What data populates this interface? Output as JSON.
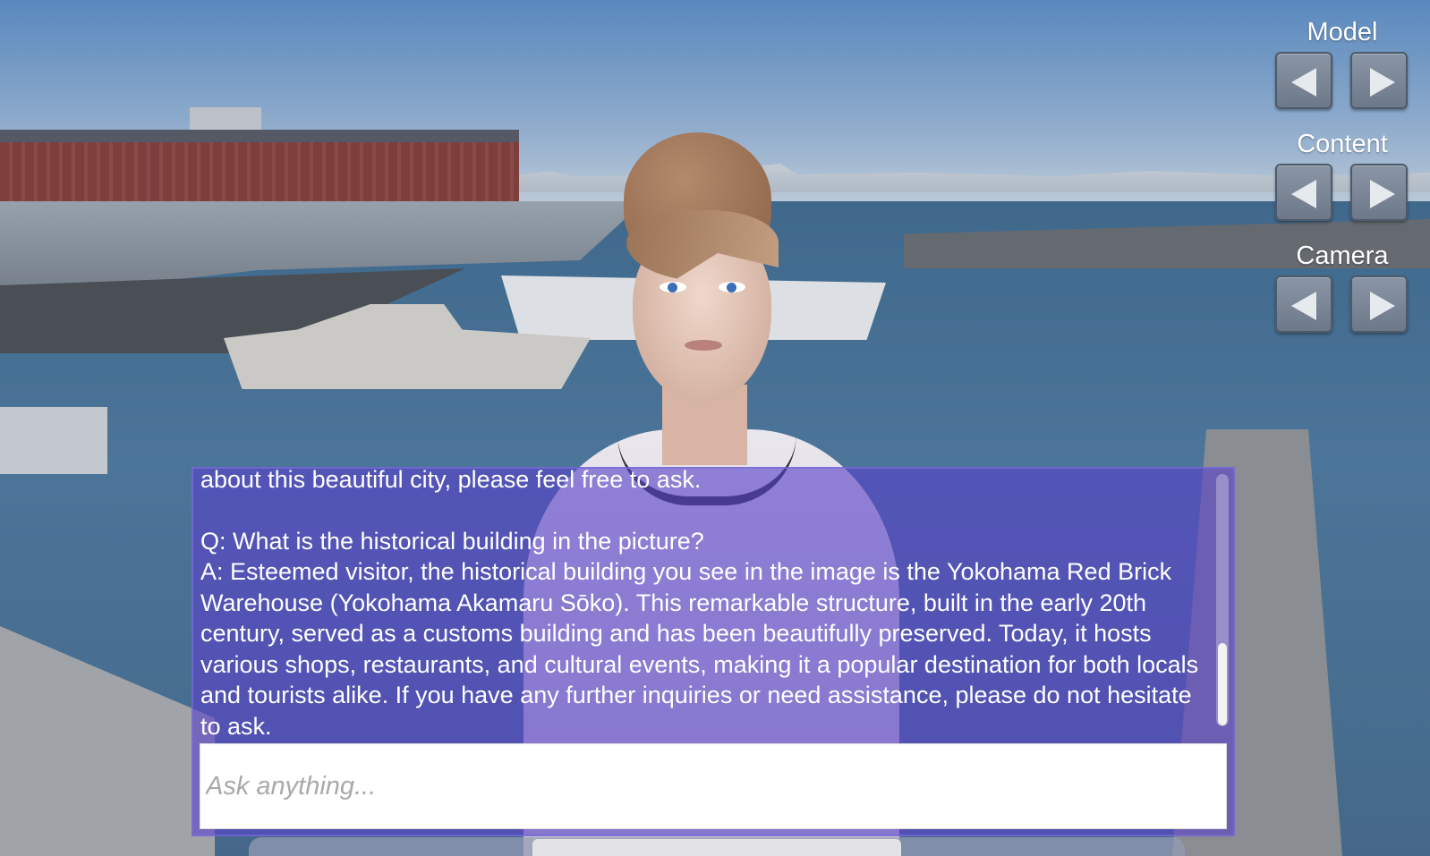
{
  "controls": {
    "model": {
      "label": "Model"
    },
    "content": {
      "label": "Content"
    },
    "camera": {
      "label": "Camera"
    }
  },
  "chat": {
    "log": {
      "cut_line": "about this beautiful city, please feel free to ask.",
      "question": "Q: What is the historical building in the picture?",
      "answer": "A: Esteemed visitor, the historical building you see in the image is the Yokohama Red Brick Warehouse (Yokohama Akamaru Sōko). This remarkable structure, built in the early 20th century, served as a customs building and has been beautifully preserved. Today, it hosts various shops, restaurants, and cultural events, making it a popular destination for both locals and tourists alike. If you have any further inquiries or need assistance, please do not hesitate to ask."
    },
    "input": {
      "placeholder": "Ask anything...",
      "value": ""
    }
  },
  "colors": {
    "chat_panel": "#5842c8",
    "button_face": "#7a8697",
    "arrow": "#e6e9ee"
  },
  "icons": {
    "prev": "triangle-left-icon",
    "next": "triangle-right-icon"
  }
}
